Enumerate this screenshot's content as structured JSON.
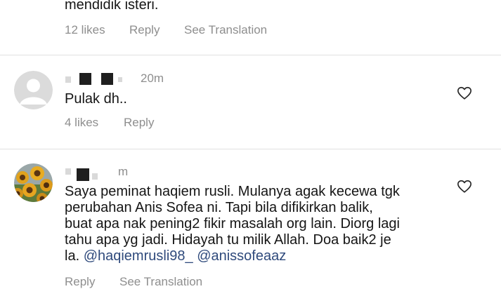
{
  "comments": [
    {
      "body_tail": "mendidik isteri.",
      "likes": "12 likes",
      "reply": "Reply",
      "see_translation": "See Translation"
    },
    {
      "time": "20m",
      "body": "Pulak dh..",
      "likes": "4 likes",
      "reply": "Reply"
    },
    {
      "time": "m",
      "body_lines": [
        "Saya peminat haqiem rusli. Mulanya agak kecewa tgk",
        "perubahan Anis Sofea ni. Tapi bila difikirkan balik,",
        "buat apa nak pening2 fikir masalah org lain. Diorg lagi",
        "tahu apa yg jadi. Hidayah tu milik Allah. Doa baik2 je"
      ],
      "last_line_prefix": "la. ",
      "mentions": [
        "@haqiemrusli98_",
        "@anissofeaaz"
      ],
      "reply": "Reply",
      "see_translation": "See Translation"
    }
  ],
  "icons": {
    "like": "heart-icon",
    "default_avatar": "default-avatar-icon",
    "sunflower_avatar": "sunflower-avatar"
  },
  "colors": {
    "meta_gray": "#8e8e8e",
    "mention_blue": "#2f4a7c",
    "divider": "#e0e0e0"
  }
}
